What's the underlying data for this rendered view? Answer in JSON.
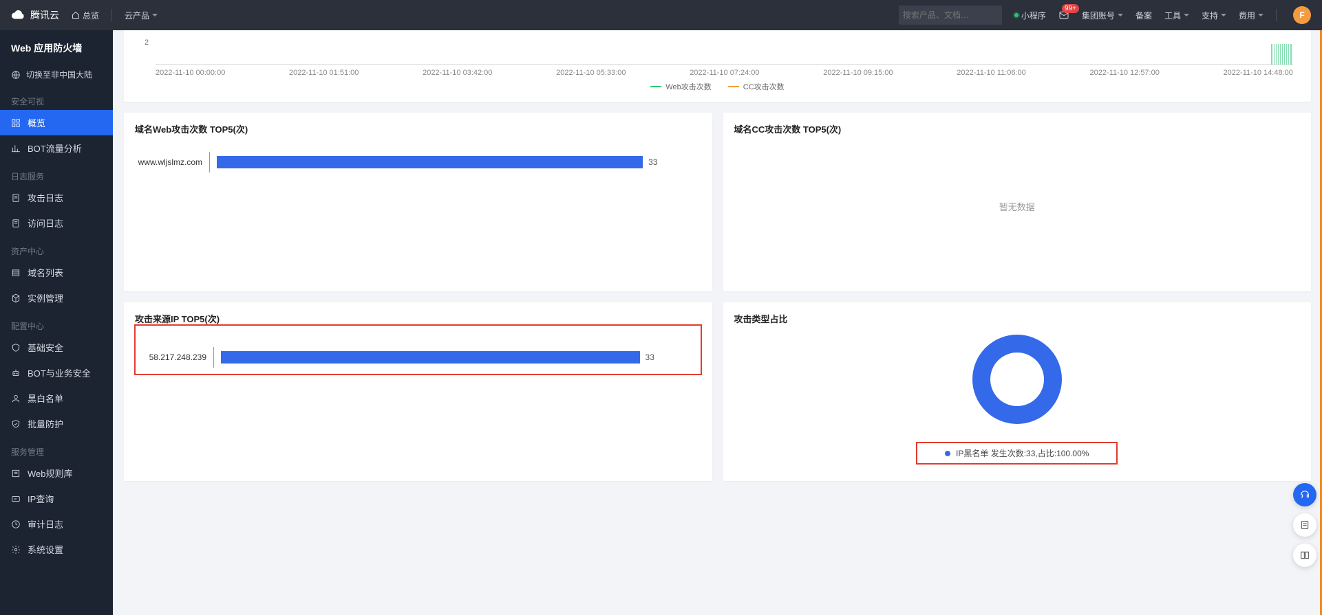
{
  "header": {
    "brand": "腾讯云",
    "overview": "总览",
    "cloud_products": "云产品",
    "search_placeholder": "搜索产品、文档…",
    "miniprogram": "小程序",
    "mail_badge": "99+",
    "group_account": "集团账号",
    "beian": "备案",
    "tools": "工具",
    "support": "支持",
    "fees": "费用",
    "avatar_letter": "F"
  },
  "sidebar": {
    "title": "Web 应用防火墙",
    "switch_region": "切换至非中国大陆",
    "sections": [
      {
        "label": "安全可视",
        "items": [
          {
            "label": "概览",
            "active": true,
            "icon": "grid"
          },
          {
            "label": "BOT流量分析",
            "icon": "chart"
          }
        ]
      },
      {
        "label": "日志服务",
        "items": [
          {
            "label": "攻击日志",
            "icon": "doc"
          },
          {
            "label": "访问日志",
            "icon": "doc"
          }
        ]
      },
      {
        "label": "资产中心",
        "items": [
          {
            "label": "域名列表",
            "icon": "list"
          },
          {
            "label": "实例管理",
            "icon": "cube"
          }
        ]
      },
      {
        "label": "配置中心",
        "items": [
          {
            "label": "基础安全",
            "icon": "shield"
          },
          {
            "label": "BOT与业务安全",
            "icon": "robot"
          },
          {
            "label": "黑白名单",
            "icon": "user"
          },
          {
            "label": "批量防护",
            "icon": "shield2"
          }
        ]
      },
      {
        "label": "服务管理",
        "items": [
          {
            "label": "Web规则库",
            "icon": "rules"
          },
          {
            "label": "IP查询",
            "icon": "ip"
          },
          {
            "label": "审计日志",
            "icon": "audit"
          },
          {
            "label": "系统设置",
            "icon": "gear"
          }
        ]
      }
    ]
  },
  "line_chart": {
    "y_label": "2",
    "ticks": [
      "2022-11-10 00:00:00",
      "2022-11-10 01:51:00",
      "2022-11-10 03:42:00",
      "2022-11-10 05:33:00",
      "2022-11-10 07:24:00",
      "2022-11-10 09:15:00",
      "2022-11-10 11:06:00",
      "2022-11-10 12:57:00",
      "2022-11-10 14:48:00"
    ],
    "legend": [
      {
        "label": "Web攻击次数",
        "color": "#34c77b"
      },
      {
        "label": "CC攻击次数",
        "color": "#f0a33f"
      }
    ]
  },
  "cards": {
    "top_web": {
      "title": "域名Web攻击次数 TOP5(次)",
      "row_label": "www.wljslmz.com",
      "row_value": "33"
    },
    "top_cc": {
      "title": "域名CC攻击次数 TOP5(次)",
      "empty": "暂无数据"
    },
    "top_ip": {
      "title": "攻击来源IP TOP5(次)",
      "row_label": "58.217.248.239",
      "row_value": "33"
    },
    "attack_type": {
      "title": "攻击类型占比",
      "legend": "IP黑名单 发生次数:33,占比:100.00%"
    }
  },
  "chart_data": [
    {
      "type": "line",
      "title": "",
      "xlabel": "",
      "ylabel": "",
      "ylim": [
        0,
        2
      ],
      "categories": [
        "2022-11-10 00:00:00",
        "2022-11-10 01:51:00",
        "2022-11-10 03:42:00",
        "2022-11-10 05:33:00",
        "2022-11-10 07:24:00",
        "2022-11-10 09:15:00",
        "2022-11-10 11:06:00",
        "2022-11-10 12:57:00",
        "2022-11-10 14:48:00"
      ],
      "series": [
        {
          "name": "Web攻击次数",
          "values": [
            0,
            0,
            0,
            0,
            0,
            0,
            0,
            0,
            2
          ]
        },
        {
          "name": "CC攻击次数",
          "values": [
            0,
            0,
            0,
            0,
            0,
            0,
            0,
            0,
            0
          ]
        }
      ]
    },
    {
      "type": "bar",
      "title": "域名Web攻击次数 TOP5(次)",
      "categories": [
        "www.wljslmz.com"
      ],
      "values": [
        33
      ],
      "xlabel": "",
      "ylabel": "",
      "ylim": [
        0,
        33
      ]
    },
    {
      "type": "bar",
      "title": "攻击来源IP TOP5(次)",
      "categories": [
        "58.217.248.239"
      ],
      "values": [
        33
      ],
      "xlabel": "",
      "ylabel": "",
      "ylim": [
        0,
        33
      ]
    },
    {
      "type": "pie",
      "title": "攻击类型占比",
      "categories": [
        "IP黑名单"
      ],
      "values": [
        33
      ],
      "percentages": [
        100.0
      ]
    }
  ]
}
